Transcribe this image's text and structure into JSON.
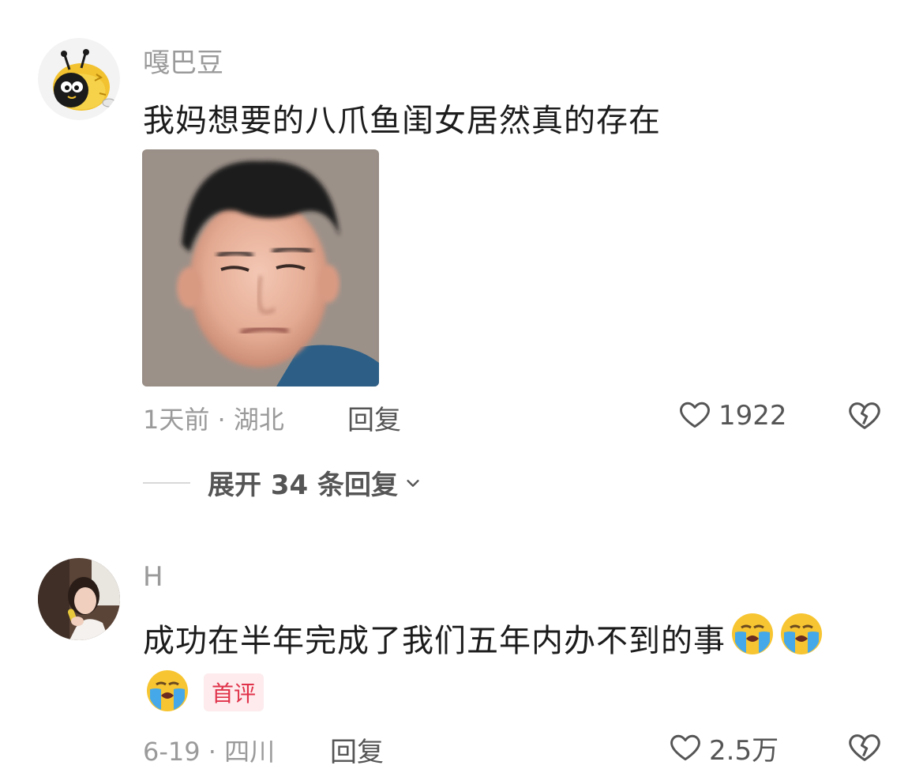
{
  "comments": [
    {
      "username": "嘎巴豆",
      "text": "我妈想要的八爪鱼闺女居然真的存在",
      "time_location": "1天前 · 湖北",
      "reply_label": "回复",
      "like_count": "1922",
      "expand_replies": "展开 34 条回复"
    },
    {
      "username": "H",
      "text": "成功在半年完成了我们五年内办不到的事",
      "badge": "首评",
      "time_location": "6-19 · 四川",
      "reply_label": "回复",
      "like_count": "2.5万"
    }
  ],
  "icons": {
    "like": "heart-outline-icon",
    "dislike": "broken-heart-icon",
    "expand": "chevron-down-icon",
    "emoji": "loudly-crying-face-emoji"
  },
  "colors": {
    "meta_gray": "#9a9a9a",
    "badge_red": "#e0334a",
    "badge_bg": "#fdebed"
  }
}
